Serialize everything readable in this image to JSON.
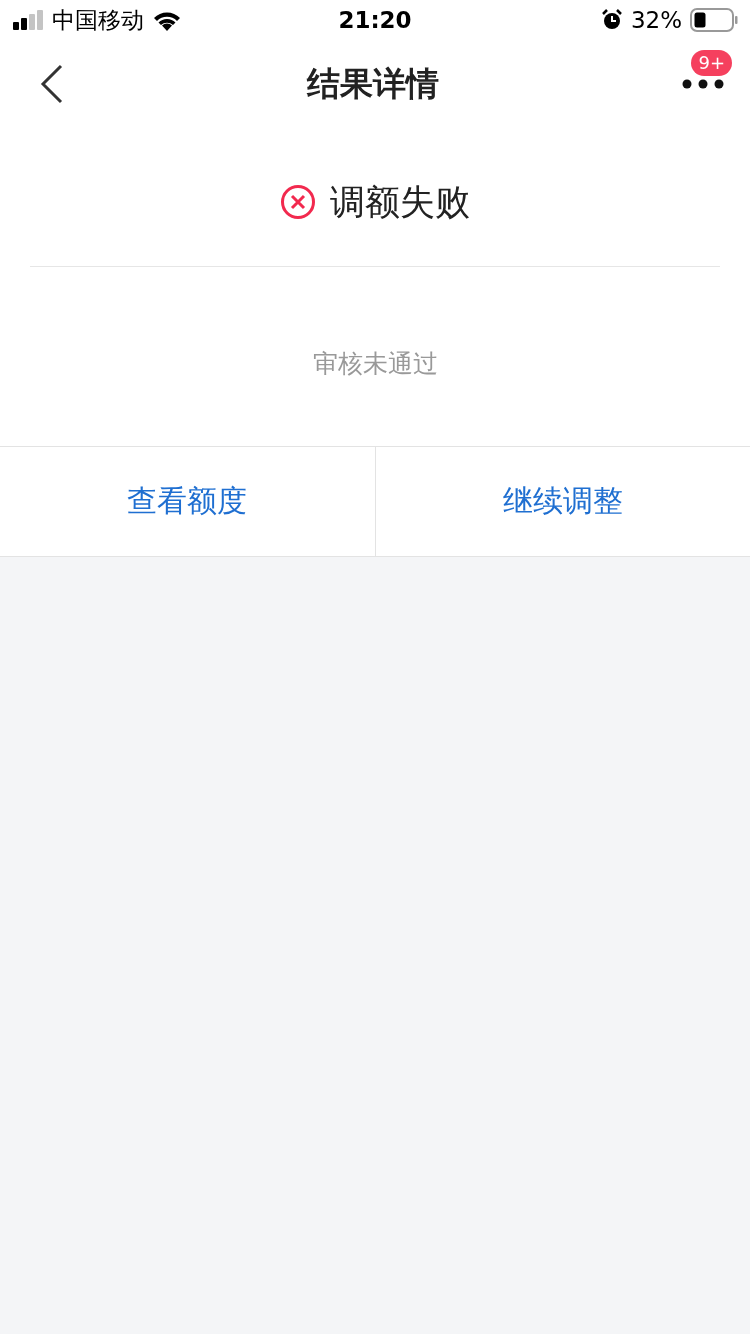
{
  "status_bar": {
    "carrier": "中国移动",
    "time": "21:20",
    "battery_percent": "32%"
  },
  "nav": {
    "title": "结果详情",
    "badge": "9+"
  },
  "result": {
    "kind": "failure",
    "title": "调额失败",
    "reason": "审核未通过"
  },
  "actions": [
    {
      "label": "查看额度"
    },
    {
      "label": "继续调整"
    }
  ]
}
